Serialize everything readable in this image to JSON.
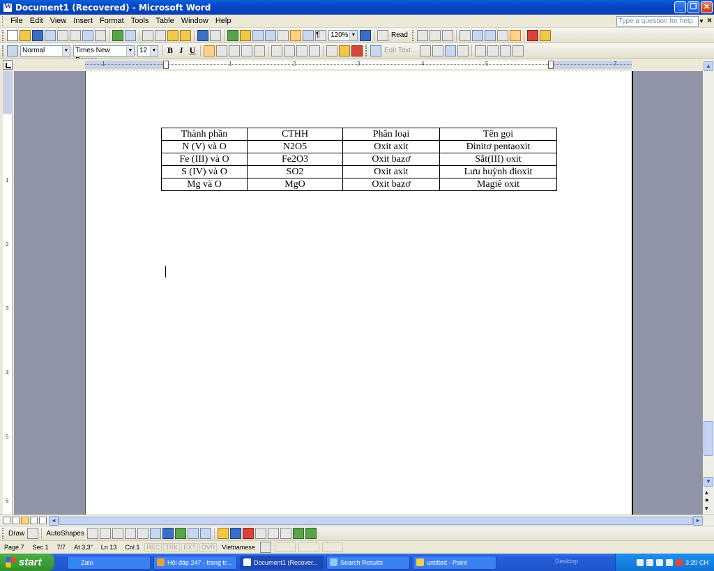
{
  "window": {
    "title": "Document1 (Recovered) - Microsoft Word"
  },
  "menu": {
    "items": [
      "File",
      "Edit",
      "View",
      "Insert",
      "Format",
      "Tools",
      "Table",
      "Window",
      "Help"
    ],
    "help_placeholder": "Type a question for help"
  },
  "standard_toolbar": {
    "zoom": "120%",
    "read_label": "Read"
  },
  "formatting_toolbar": {
    "style": "Normal",
    "font": "Times New Roman",
    "size": "12",
    "bold": "B",
    "italic": "I",
    "underline": "U",
    "edit_text_label": "Edit Text..."
  },
  "document": {
    "table": {
      "headers": [
        "Thành phần",
        "CTHH",
        "Phân loại",
        "Tên gọi"
      ],
      "rows": [
        [
          "N (V) và O",
          "N2O5",
          "Oxit axit",
          "Đinitơ pentaoxit"
        ],
        [
          "Fe (III) và O",
          "Fe2O3",
          "Oxit bazơ",
          "Sắt(III) oxit"
        ],
        [
          "S (IV) và O",
          "SO2",
          "Oxit axit",
          "Lưu huỳnh đioxit"
        ],
        [
          "Mg và O",
          "MgO",
          "Oxit bazơ",
          "Magiê oxit"
        ]
      ]
    }
  },
  "drawing_toolbar": {
    "draw_label": "Draw",
    "autoshapes_label": "AutoShapes"
  },
  "status": {
    "page": "Page 7",
    "sec": "Sec 1",
    "pages": "7/7",
    "at": "At 3,3\"",
    "ln": "Ln 13",
    "col": "Col 1",
    "rec": "REC",
    "trk": "TRK",
    "ext": "EXT",
    "ovr": "OVR",
    "language": "Vietnamese"
  },
  "taskbar": {
    "start_label": "start",
    "tasks": [
      "Zalo",
      "Hỏi đáp 247 - trang tr...",
      "Document1 (Recover...",
      "Search Results",
      "untitled - Paint"
    ],
    "desktop_label": "Desktop",
    "clock": "3:20 CH"
  },
  "colors": {
    "titlebar": "#0347c6",
    "taskbar": "#245edb",
    "start": "#2f8f2a"
  }
}
